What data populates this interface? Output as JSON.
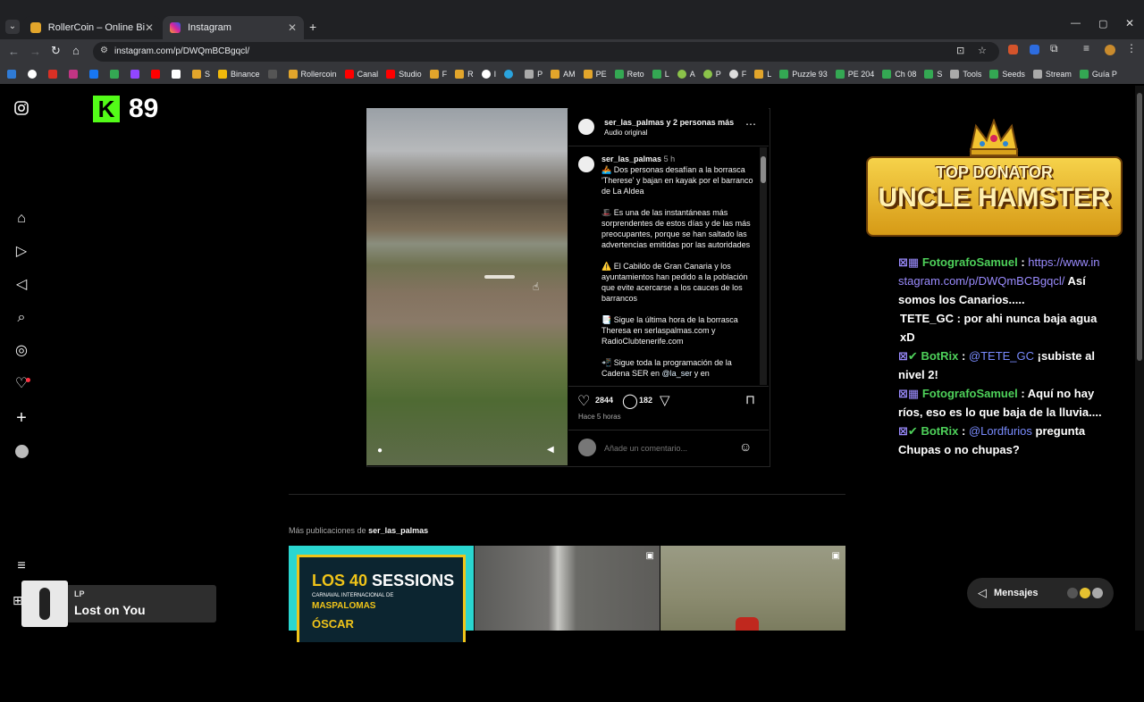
{
  "browser": {
    "tabs": [
      {
        "title": "RollerCoin – Online Bitcoin Mi",
        "active": false
      },
      {
        "title": "Instagram",
        "active": true
      }
    ],
    "url": "instagram.com/p/DWQmBCBgqcl/",
    "bookmarks": [
      "S",
      "Binance",
      "Rollercoin",
      "Canal",
      "Studio",
      "F",
      "R",
      "I",
      "P",
      "AM",
      "PE",
      "Reto",
      "L",
      "A",
      "P",
      "F",
      "L",
      "Puzzle 93",
      "PE 204",
      "Ch 08",
      "S",
      "Tools",
      "Seeds",
      "Stream",
      "Guía P"
    ]
  },
  "overlay": {
    "kick_count": "89",
    "top_donator_line1": "TOP DONATOR",
    "top_donator_line2": "UNCLE HAMSTER"
  },
  "post": {
    "header_user": "ser_las_palmas y 2 personas más",
    "header_audio": "Audio original",
    "caption_user": "ser_las_palmas",
    "caption_time": "5 h",
    "caption_p1": "🚣 Dos personas desafían a la borrasca 'Therese' y bajan en kayak por el barranco de La Aldea",
    "caption_p2": "🎩 Es una de las instantáneas más sorprendentes de estos días y de las más preocupantes, porque se han saltado las advertencias emitidas por las autoridades",
    "caption_p3": "⚠️ El Cabildo de Gran Canaria y los ayuntamientos han pedido a la población que evite acercarse a los cauces de los barrancos",
    "caption_p4": "📑 Sigue la última hora de la borrasca Theresa en serlaspalmas.com y RadioClubtenerife.com",
    "caption_p5a": "📲 Sigue toda la programación de la Cadena SER en ",
    "caption_p5b": "@la_ser",
    "caption_p5c": " y en",
    "likes": "2844",
    "comments": "182",
    "time_ago": "Hace 5 horas",
    "comment_placeholder": "Añade un comentario..."
  },
  "more": {
    "label_prefix": "Más publicaciones de ",
    "label_user": "ser_las_palmas",
    "thumb1_line1": "LOS 40",
    "thumb1_line2": "SESSIONS",
    "thumb1_line3": "CARNAVAL INTERNACIONAL DE",
    "thumb1_line4": "MASPALOMAS",
    "thumb1_line5": "ÓSCAR"
  },
  "chat": [
    {
      "user": "FotografoSamuel",
      "sep": " : ",
      "link": "https://www.instagram.com/p/DWQmBCBgqcl/",
      "text": " Así somos los Canarios....."
    },
    {
      "user": "TETE_GC",
      "sep": " : ",
      "text": "por ahi nunca baja agua xD"
    },
    {
      "user": "BotRix",
      "sep": " : ",
      "mention": "@TETE_GC",
      "text": " ¡subiste al nivel 2!"
    },
    {
      "user": "FotografoSamuel",
      "sep": " : ",
      "text": "Aquí no hay ríos, eso es lo que baja de la lluvia...."
    },
    {
      "user": "BotRix",
      "sep": " : ",
      "mention": "@Lordfurios",
      "text": " pregunta Chupas o no chupas?"
    }
  ],
  "music": {
    "artist": "LP",
    "title": "Lost on You"
  },
  "messages_label": "Mensajes"
}
